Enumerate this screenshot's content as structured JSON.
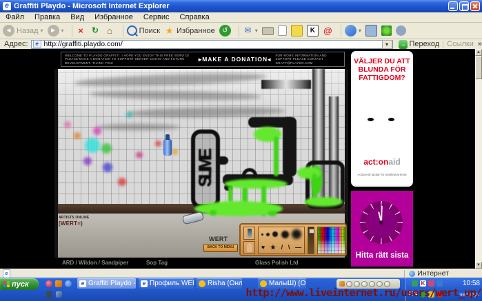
{
  "window": {
    "title": "Graffiti Playdo - Microsoft Internet Explorer"
  },
  "icons": {
    "ie": "e",
    "back_arrow": "◄",
    "forward_arrow": "►",
    "stop": "×",
    "refresh": "↻",
    "home": "⌂",
    "history": "↺",
    "mail": "✉",
    "star": "★",
    "dropdown": "▾",
    "go": "→",
    "at": "@",
    "k": "K",
    "up": "▲",
    "down": "▼"
  },
  "menu": {
    "items": [
      "Файл",
      "Правка",
      "Вид",
      "Избранное",
      "Сервис",
      "Справка"
    ]
  },
  "toolbar": {
    "back": "Назад",
    "search": "Поиск",
    "favorites": "Избранное"
  },
  "address": {
    "label": "Адрес:",
    "value": "http://graffiti.playdo.com/",
    "go": "Переход",
    "links": "Ссылки",
    "links_more": "»"
  },
  "banner": {
    "welcome": "WELCOME TO PLAYDO GRAFFITI. I HOPE YOU ENJOY THIS FREE SERVICE. PLEASE MAKE A DONATION TO SUPPORT SERVER COSTS AND FUTURE DEVELOPMENT. THANK YOU!",
    "arrow_left": "▸",
    "donation": "MAKE A DONATION",
    "arrow_right": "◂",
    "contact": "FOR MORE INFORMATION AND SUPPORT PLEASE CONTACT GRAFF@PLAYDO.COM"
  },
  "game": {
    "artists_online": "ARTISTS ONLINE",
    "artist_name": "[WERT=)",
    "graffiti_word": "SLIME",
    "player_name": "WERT",
    "back_to_menu": "BACK TO MENU",
    "tools": [
      "♥",
      "★",
      "/",
      "\\",
      "—"
    ]
  },
  "links_row": [
    "ARD / Wildon / Sandpiper",
    "Sop Tag",
    "Glass Polish Ltd"
  ],
  "ads": {
    "actionaid": {
      "headline": "VÄLJER DU ATT BLUNDA FÖR FATTIGDOM?",
      "logo_bold": "act:on",
      "logo_light": "aid",
      "caption": "ActionAid tackar för medieutrymmet"
    },
    "clock": {
      "caption": "Hitta rätt sista"
    }
  },
  "statusbar": {
    "zone": "Интернет"
  },
  "taskbar": {
    "start": "пуск",
    "tasks": [
      {
        "label": "Graffiti Playdo - Micro..."
      },
      {
        "label": "Профиль WERT_UP -..."
      },
      {
        "label": "Risha (Онлайн)"
      },
      {
        "label": "МалыШ) (Отошел)"
      }
    ],
    "tray": {
      "lang": "EN",
      "time": "10:58",
      "day": "четверг"
    }
  },
  "watermark": {
    "text": "http://www.liveinternet.ru/users/wert_up/"
  },
  "colors": {
    "titlebar_blue": "#2558cf",
    "taskbar_blue": "#2460d8",
    "start_green": "#3f9b3f",
    "slime_green": "#3ed414",
    "ad_magenta": "#b3009b",
    "actionaid_red": "#e2001a",
    "watermark_red": "#7e100a"
  }
}
